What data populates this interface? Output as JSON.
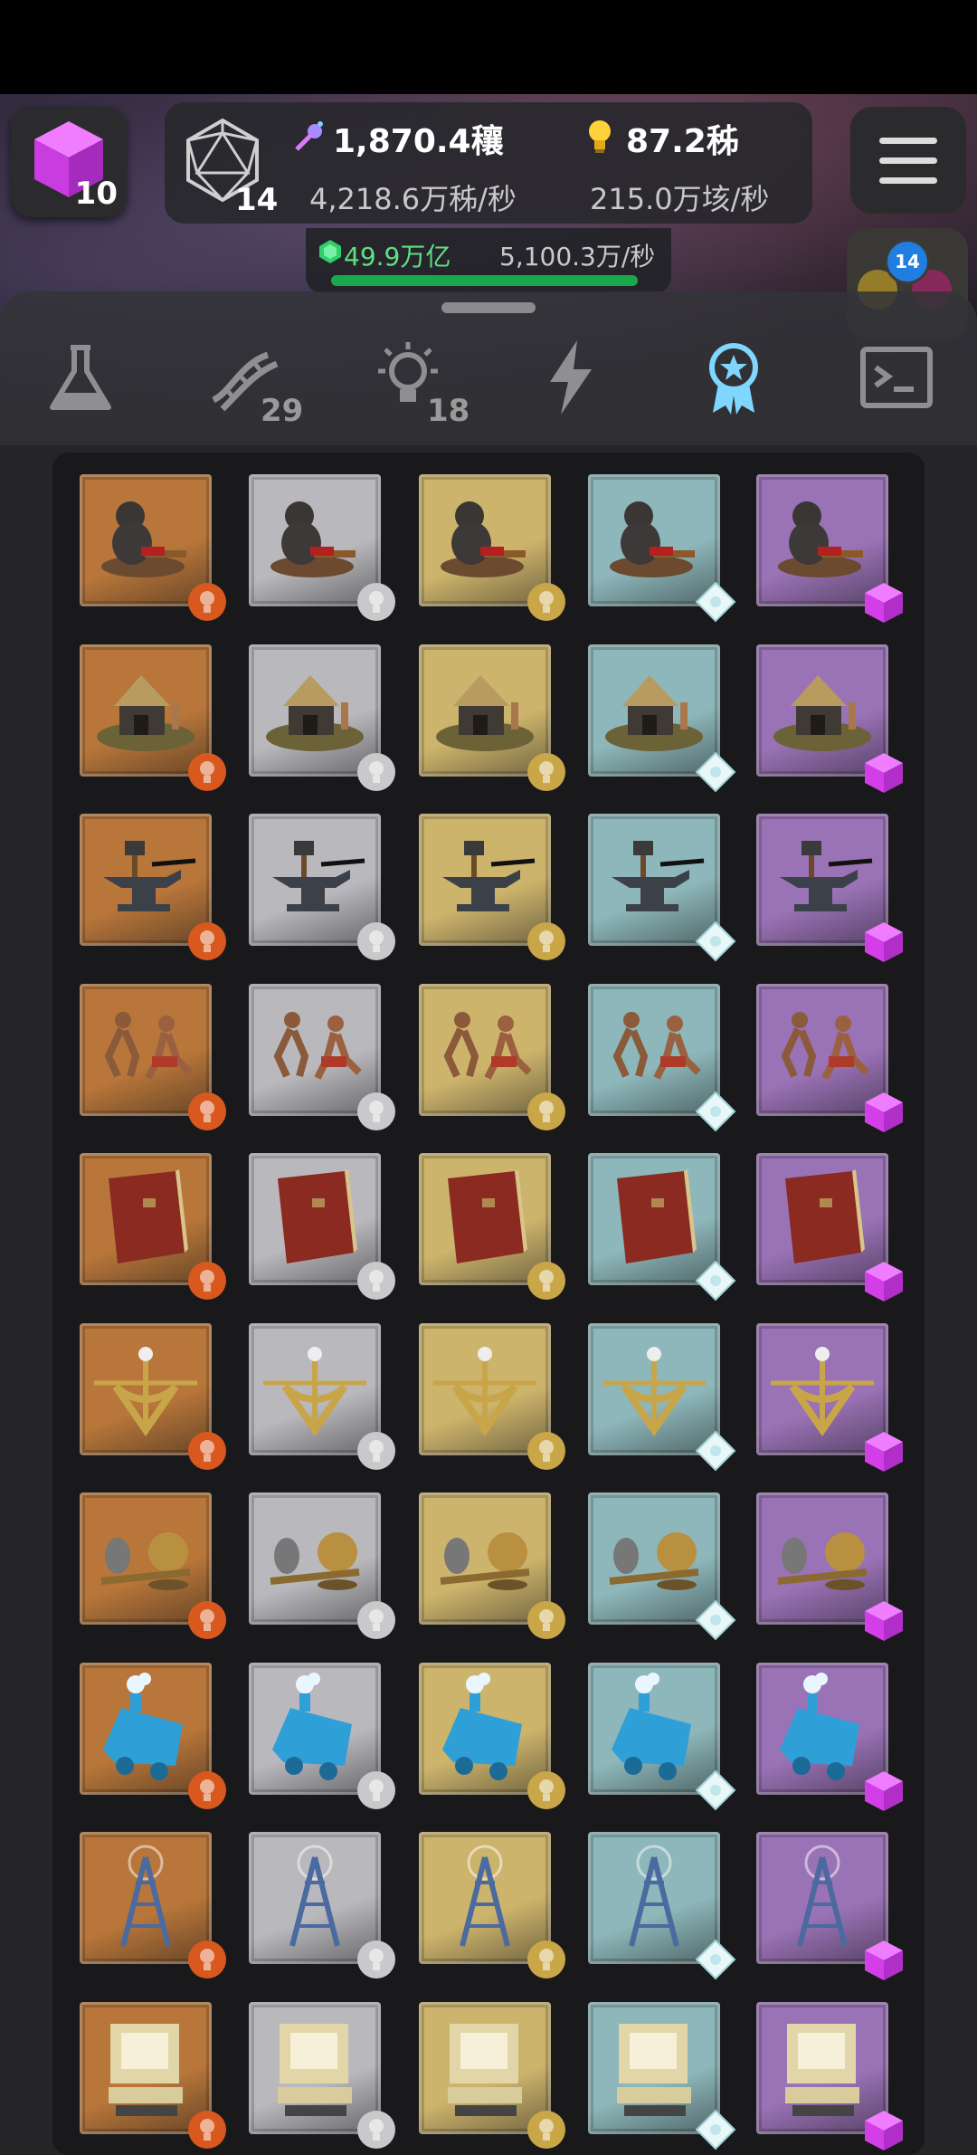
{
  "hud": {
    "cube_count": "10",
    "d20_count": "14",
    "energy_value": "1,870.4穰",
    "energy_rate": "4,218.6万秭/秒",
    "idea_value": "87.2秭",
    "idea_rate": "215.0万垓/秒",
    "gem_value": "49.9万亿",
    "gem_rate": "5,100.3万/秒",
    "gem_progress": 0.98,
    "orb_badge": "14"
  },
  "tabs": [
    {
      "icon": "flask-icon",
      "badge": ""
    },
    {
      "icon": "dna-icon",
      "badge": "29"
    },
    {
      "icon": "lightbulb-icon",
      "badge": "18"
    },
    {
      "icon": "lightning-icon",
      "badge": ""
    },
    {
      "icon": "award-ribbon-icon",
      "badge": "",
      "selected": true
    },
    {
      "icon": "terminal-icon",
      "badge": ""
    }
  ],
  "tiers": [
    {
      "name": "bronze",
      "color": "#b8763a",
      "badge": "bronze-coin-icon"
    },
    {
      "name": "silver",
      "color": "#b9b9bd",
      "badge": "silver-coin-icon"
    },
    {
      "name": "gold",
      "color": "#cdb46c",
      "badge": "gold-coin-icon"
    },
    {
      "name": "diamond",
      "color": "#8db7ba",
      "badge": "diamond-icon"
    },
    {
      "name": "amethyst",
      "color": "#9a72b6",
      "badge": "purple-cube-icon"
    }
  ],
  "rows": [
    {
      "name": "ape-with-tools",
      "icon": "ape-icon"
    },
    {
      "name": "hut",
      "icon": "hut-icon"
    },
    {
      "name": "anvil",
      "icon": "anvil-icon"
    },
    {
      "name": "dancers",
      "icon": "dancers-icon"
    },
    {
      "name": "book",
      "icon": "book-icon"
    },
    {
      "name": "sextant",
      "icon": "sextant-icon"
    },
    {
      "name": "globe-instrument",
      "icon": "globe-icon"
    },
    {
      "name": "steam-locomotive",
      "icon": "locomotive-icon"
    },
    {
      "name": "radio-tower",
      "icon": "radio-tower-icon"
    },
    {
      "name": "computer",
      "icon": "computer-icon"
    }
  ]
}
